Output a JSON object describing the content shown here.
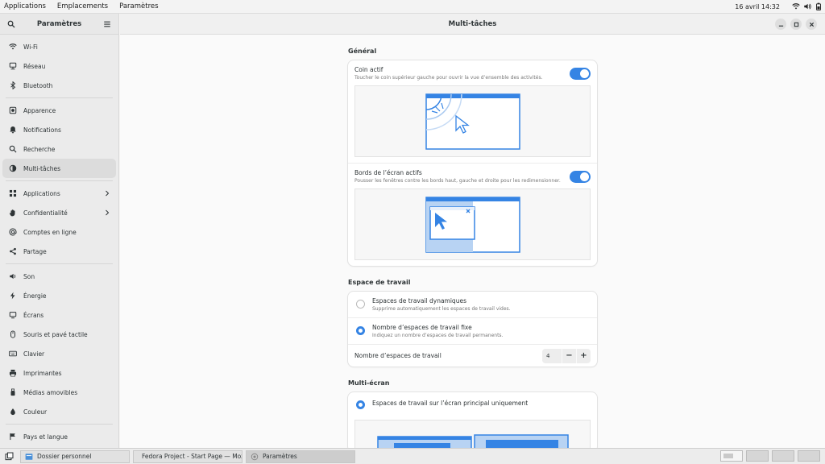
{
  "topbar": {
    "menus": [
      "Applications",
      "Emplacements",
      "Paramètres"
    ],
    "clock": "16 avril  14:32",
    "tray_icons": [
      "wifi-icon",
      "volume-icon",
      "battery-icon"
    ]
  },
  "sidebar": {
    "title": "Paramètres",
    "items": [
      {
        "label": "Wi-Fi",
        "icon": "wifi-icon"
      },
      {
        "label": "Réseau",
        "icon": "network-icon"
      },
      {
        "label": "Bluetooth",
        "icon": "bluetooth-icon"
      },
      {
        "label": "Apparence",
        "icon": "appearance-icon"
      },
      {
        "label": "Notifications",
        "icon": "bell-icon"
      },
      {
        "label": "Recherche",
        "icon": "search-icon"
      },
      {
        "label": "Multi-tâches",
        "icon": "multitasking-icon"
      },
      {
        "label": "Applications",
        "icon": "apps-icon"
      },
      {
        "label": "Confidentialité",
        "icon": "hand-icon"
      },
      {
        "label": "Comptes en ligne",
        "icon": "at-icon"
      },
      {
        "label": "Partage",
        "icon": "share-icon"
      },
      {
        "label": "Son",
        "icon": "speaker-icon"
      },
      {
        "label": "Énergie",
        "icon": "power-icon"
      },
      {
        "label": "Écrans",
        "icon": "display-icon"
      },
      {
        "label": "Souris et pavé tactile",
        "icon": "mouse-icon"
      },
      {
        "label": "Clavier",
        "icon": "keyboard-icon"
      },
      {
        "label": "Imprimantes",
        "icon": "printer-icon"
      },
      {
        "label": "Médias amovibles",
        "icon": "usb-icon"
      },
      {
        "label": "Couleur",
        "icon": "color-icon"
      },
      {
        "label": "Pays et langue",
        "icon": "flag-icon"
      }
    ],
    "active": "Multi-tâches"
  },
  "main": {
    "title": "Multi-tâches",
    "general": {
      "title": "Général",
      "hot_corner": {
        "title": "Coin actif",
        "subtitle": "Toucher le coin supérieur gauche pour ouvrir la vue d’ensemble des activités.",
        "enabled": true
      },
      "edges": {
        "title": "Bords de l’écran actifs",
        "subtitle": "Pousser les fenêtres contre les bords haut, gauche et droite pour les redimensionner.",
        "enabled": true
      }
    },
    "workspaces": {
      "title": "Espace de travail",
      "dynamic": {
        "title": "Espaces de travail dynamiques",
        "subtitle": "Supprime automatiquement les espaces de travail vides.",
        "selected": false
      },
      "fixed": {
        "title": "Nombre d’espaces de travail fixe",
        "subtitle": "Indiquez un nombre d’espaces de travail permanents.",
        "selected": true
      },
      "count_label": "Nombre d’espaces de travail",
      "count_value": "4",
      "minus": "−",
      "plus": "+"
    },
    "multiscreen": {
      "title": "Multi-écran",
      "primary_only": {
        "title": "Espaces de travail sur l’écran principal uniquement",
        "selected": true
      }
    }
  },
  "taskbar": {
    "tasks": [
      {
        "label": "Dossier personnel",
        "icon": "folder-icon"
      },
      {
        "label": "Fedora Project - Start Page — Moz…",
        "icon": "firefox-icon"
      },
      {
        "label": "Paramètres",
        "icon": "settings-icon"
      }
    ],
    "workspaces": 4,
    "current_workspace": 1
  },
  "colors": {
    "accent": "#3584e4"
  }
}
